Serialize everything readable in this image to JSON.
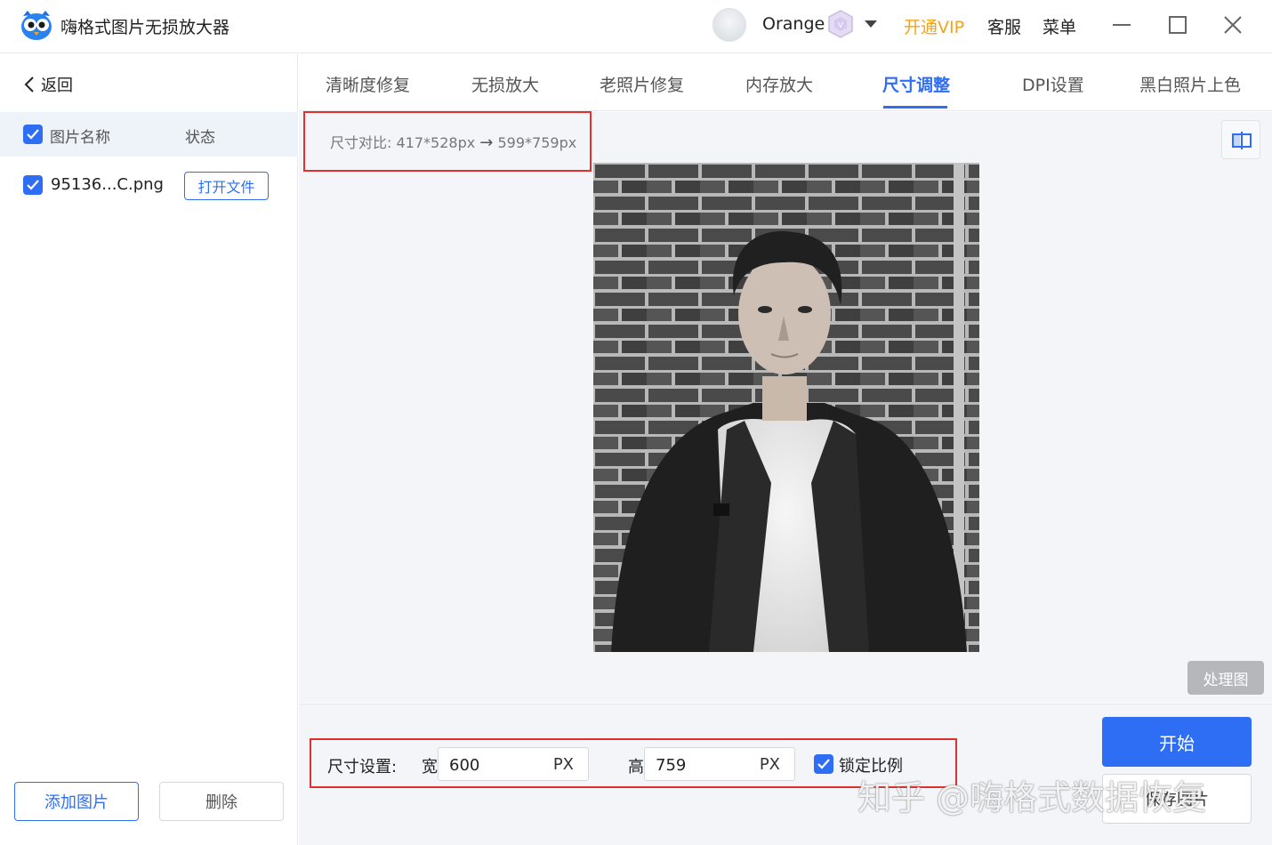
{
  "window": {
    "title": "嗨格式图片无损放大器",
    "user_name": "Orange",
    "vip_link": "开通VIP",
    "service_link": "客服",
    "menu_link": "菜单"
  },
  "sidebar": {
    "back_label": "返回",
    "header_name": "图片名称",
    "header_status": "状态",
    "files": [
      {
        "name": "95136...C.png",
        "action": "打开文件",
        "checked": true
      }
    ],
    "add_button": "添加图片",
    "delete_button": "删除"
  },
  "tabs": [
    {
      "label": "清晰度修复",
      "active": false
    },
    {
      "label": "无损放大",
      "active": false
    },
    {
      "label": "老照片修复",
      "active": false
    },
    {
      "label": "内存放大",
      "active": false
    },
    {
      "label": "尺寸调整",
      "active": true
    },
    {
      "label": "DPI设置",
      "active": false
    },
    {
      "label": "黑白照片上色",
      "active": false
    }
  ],
  "preview": {
    "compare_label": "尺寸对比:",
    "original_size": "417*528px",
    "new_size": "599*759px",
    "processed_button": "处理图"
  },
  "settings": {
    "label": "尺寸设置:",
    "width_label": "宽",
    "width_value": "600",
    "width_unit": "PX",
    "height_label": "高",
    "height_value": "759",
    "height_unit": "PX",
    "lock_ratio_label": "锁定比例",
    "lock_ratio_checked": true
  },
  "actions": {
    "start_button": "开始",
    "save_button": "保存图片"
  },
  "watermark": "知乎 @嗨格式数据恢复",
  "colors": {
    "accent": "#2e6ef5",
    "vip": "#f0a418",
    "highlight_box": "#e0302e"
  },
  "icons": {
    "logo": "owl-logo-icon",
    "vip": "vip-badge-icon",
    "dropdown": "caret-down-icon",
    "minimize": "minimize-icon",
    "maximize": "maximize-icon",
    "close": "close-icon",
    "back": "chevron-left-icon",
    "check": "checkmark-icon",
    "compare": "split-view-icon"
  }
}
